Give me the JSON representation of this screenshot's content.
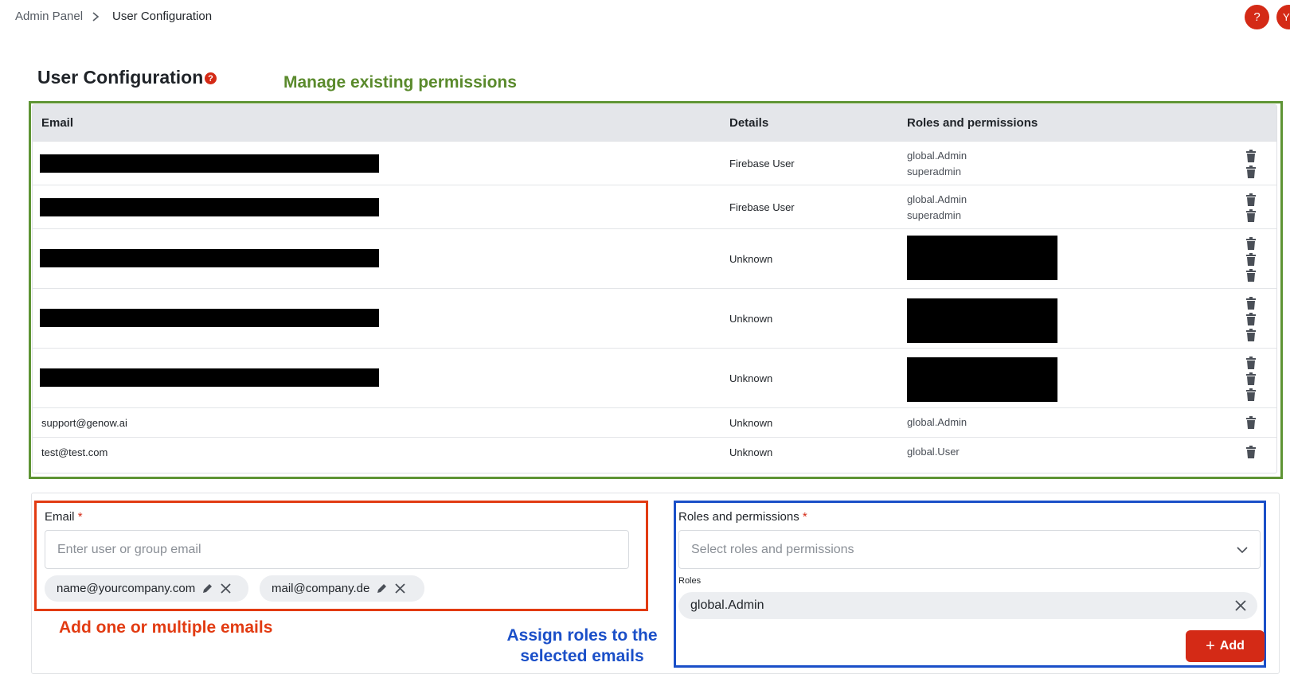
{
  "breadcrumb": {
    "parent": "Admin Panel",
    "current": "User Configuration"
  },
  "header": {
    "help_glyph": "?",
    "avatar_initial": "Y"
  },
  "page": {
    "title": "User Configuration",
    "help_glyph": "?"
  },
  "annotations": {
    "manage": "Manage existing permissions",
    "add_emails": "Add one or multiple emails",
    "assign_roles_line1": "Assign roles to the",
    "assign_roles_line2": "selected emails"
  },
  "table": {
    "headers": {
      "email": "Email",
      "details": "Details",
      "roles": "Roles and permissions"
    },
    "rows": [
      {
        "email": "",
        "email_redacted": true,
        "details": "Firebase User",
        "roles": [
          "global.Admin",
          "superadmin"
        ],
        "roles_redacted": false
      },
      {
        "email": "",
        "email_redacted": true,
        "details": "Firebase User",
        "roles": [
          "global.Admin",
          "superadmin"
        ],
        "roles_redacted": false
      },
      {
        "email": "",
        "email_redacted": true,
        "details": "Unknown",
        "roles": [],
        "roles_redacted": true,
        "role_count": 3
      },
      {
        "email": "",
        "email_redacted": true,
        "details": "Unknown",
        "roles": [],
        "roles_redacted": true,
        "role_count": 3
      },
      {
        "email": "",
        "email_redacted": true,
        "details": "Unknown",
        "roles": [],
        "roles_redacted": true,
        "role_count": 3
      },
      {
        "email": "support@genow.ai",
        "email_redacted": false,
        "details": "Unknown",
        "roles": [
          "global.Admin"
        ],
        "roles_redacted": false
      },
      {
        "email": "test@test.com",
        "email_redacted": false,
        "details": "Unknown",
        "roles": [
          "global.User"
        ],
        "roles_redacted": false
      }
    ]
  },
  "form": {
    "email_label": "Email",
    "required_mark": "*",
    "email_placeholder": "Enter user or group email",
    "email_chips": [
      "name@yourcompany.com",
      "mail@company.de"
    ],
    "roles_label": "Roles and permissions",
    "roles_placeholder": "Select roles and permissions",
    "roles_group_label": "Roles",
    "selected_roles": [
      "global.Admin"
    ],
    "add_plus": "+",
    "add_button": "Add"
  },
  "colors": {
    "accent_red": "#d42a16",
    "annot_green": "#5e9434",
    "annot_red": "#e23b12",
    "annot_blue": "#1a4fc8"
  },
  "icons": [
    "chevron-right-icon",
    "help-icon",
    "trash-icon",
    "pencil-icon",
    "close-icon",
    "chevron-down-icon",
    "plus-icon"
  ]
}
